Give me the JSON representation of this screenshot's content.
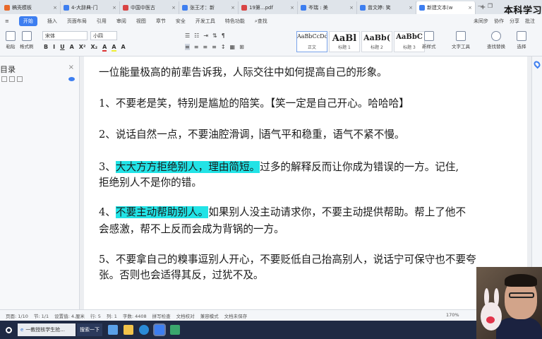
{
  "watermark": "本科学习",
  "tabs": [
    {
      "label": "稿壳模板",
      "color": "#e8692a",
      "active": false
    },
    {
      "label": "4-大辞典-门",
      "color": "#3d7ef0",
      "active": false
    },
    {
      "label": "中国中医古",
      "color": "#d94444",
      "active": false
    },
    {
      "label": "张王才：新",
      "color": "#3d7ef0",
      "active": false
    },
    {
      "label": "19第...pdf",
      "color": "#d94444",
      "active": false
    },
    {
      "label": "岑瑞 : 美",
      "color": "#3d7ef0",
      "active": false
    },
    {
      "label": "曾文婷: 笑",
      "color": "#3d7ef0",
      "active": false
    },
    {
      "label": "新建文本(w",
      "color": "#3d7ef0",
      "active": true
    }
  ],
  "tab_plus": "+",
  "menu": {
    "start": "开始",
    "items": [
      "插入",
      "页面布局",
      "引用",
      "审阅",
      "视图",
      "章节",
      "安全",
      "开发工具",
      "特色功能"
    ],
    "search": "查找",
    "right": [
      "未同步",
      "协作",
      "分享",
      "批注"
    ]
  },
  "ribbon": {
    "paste": "粘贴",
    "format_painter": "格式刷",
    "font_name": "宋体",
    "font_size": "小四",
    "format_buttons": [
      "B",
      "I",
      "U",
      "A",
      "X²",
      "X₂",
      "A",
      "A",
      "A"
    ],
    "styles": [
      {
        "preview": "AaBbCcDd",
        "label": "正文"
      },
      {
        "preview": "AaBl",
        "label": "标题 1"
      },
      {
        "preview": "AaBb(",
        "label": "标题 2"
      },
      {
        "preview": "AaBbC",
        "label": "标题 3"
      }
    ],
    "new_style": "新样式",
    "text_tools": "文字工具",
    "find_replace": "查找替换",
    "select": "选择"
  },
  "sidebar": {
    "title": "目录",
    "close": "×"
  },
  "document": {
    "intro": "一位能量极高的前辈告诉我，人际交往中如何提高自己的形象。",
    "p1": "1、不要老是笑，特别是尴尬的陪笑。【笑一定是自己开心。哈哈哈】",
    "p2_before": "2、说话自然一点，不要油腔滑调，",
    "p2_after": "语气平和稳重，语气不紧不慢。",
    "p3_prefix": "3、",
    "p3_highlight": "大大方方拒绝别人，理由简短。",
    "p3_rest": "过多的解释反而让你成为错误的一方。记住,",
    "p3_line2": "拒绝别人不是你的错。",
    "p4_prefix": "4、",
    "p4_highlight": "不要主动帮助别人。",
    "p4_rest": "如果别人没主动请求你，不要主动提供帮助。帮上了他不",
    "p4_line2": "会感激，帮不上反而会成为背锅的一方。",
    "p5_line1": "5、不要拿自己的糗事逗别人开心，不要贬低自己抬高别人，说话宁可保守也不要夸",
    "p5_line2": "张。否则也会适得其反，过犹不及。",
    "highlight_color": "#22e3e6"
  },
  "status": {
    "page": "页面: 1/10",
    "section": "节: 1/1",
    "setting": "设置值: 4.厘米",
    "row": "行: 5",
    "col": "列: 1",
    "words": "字数: 4408",
    "spell": "拼写检查",
    "doc_check": "文档校对",
    "compat": "兼容模式",
    "unsaved": "文档未保存",
    "zoom": "170%"
  },
  "taskbar": {
    "search_text": "一教授核学生抢...",
    "search_btn": "搜索一下"
  }
}
